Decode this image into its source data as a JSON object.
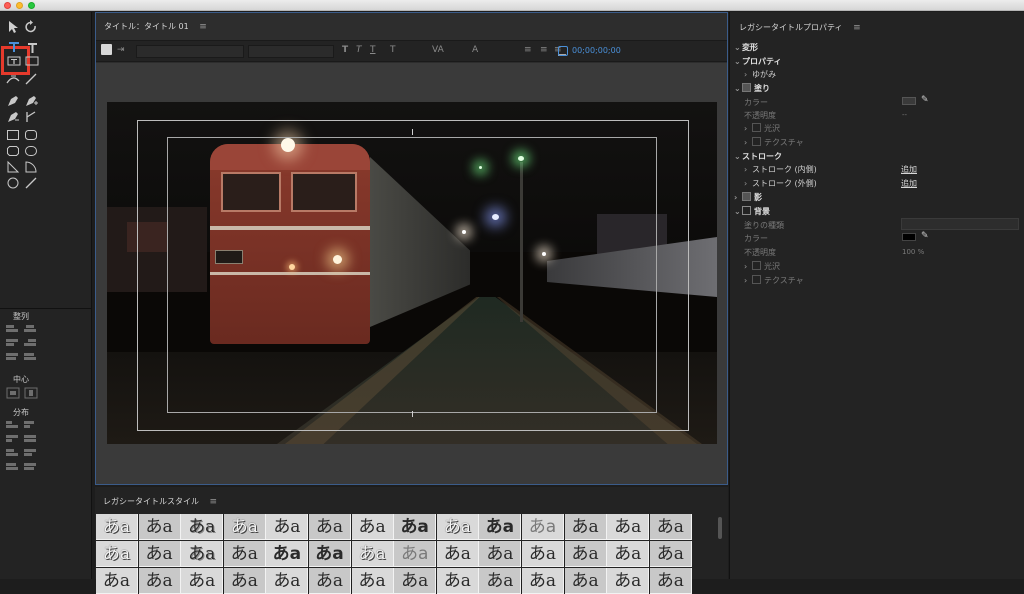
{
  "window": {
    "controls": [
      "close",
      "minimize",
      "zoom"
    ]
  },
  "tools": {
    "sections": {
      "align": "整列",
      "center": "中心",
      "distribute": "分布"
    },
    "selected_tool": "type-tool"
  },
  "editor": {
    "tab_title": "タイトル：タイトル 01",
    "menu_icon": "≡",
    "timecode": "00;00;00;00",
    "toolbar_glyphs": {
      "bold": "T",
      "italic": "T",
      "underline": "T",
      "size": "T",
      "kerning": "VA",
      "leading": "A"
    }
  },
  "styles_panel": {
    "title": "レガシータイトルスタイル",
    "menu_icon": "≡",
    "swatch_text": "あa",
    "rows": [
      [
        "outline",
        "plain",
        "shadow",
        "outline",
        "plain",
        "plain",
        "plain",
        "bold",
        "outline",
        "bold",
        "light",
        "plain",
        "plain",
        "plain"
      ],
      [
        "outline",
        "plain",
        "shadow",
        "plain",
        "bold",
        "bold",
        "outline",
        "light",
        "plain",
        "plain",
        "plain",
        "plain",
        "plain",
        "plain"
      ],
      [
        "plain",
        "plain",
        "plain",
        "plain",
        "plain",
        "plain",
        "plain",
        "plain",
        "plain",
        "plain",
        "plain",
        "plain",
        "plain",
        "plain"
      ]
    ]
  },
  "properties": {
    "title": "レガシータイトルプロパティ",
    "menu_icon": "≡",
    "transform": "変形",
    "props_section": "プロパティ",
    "distort": "ゆがみ",
    "fill": "塗り",
    "color": "カラー",
    "opacity": "不透明度",
    "sheen": "光沢",
    "texture": "テクスチャ",
    "stroke": "ストローク",
    "inner_stroke": "ストローク (内側)",
    "outer_stroke": "ストローク (外側)",
    "add": "追加",
    "shadow": "影",
    "background": "背景",
    "fill_type": "塗りの種類",
    "bg_color": "カラー",
    "bg_opacity": "不透明度",
    "bg_opacity_value": "100 %",
    "bg_sheen": "光沢",
    "bg_texture": "テクスチャ",
    "fill_opacity_value": "--",
    "fill_color_value": "--"
  }
}
